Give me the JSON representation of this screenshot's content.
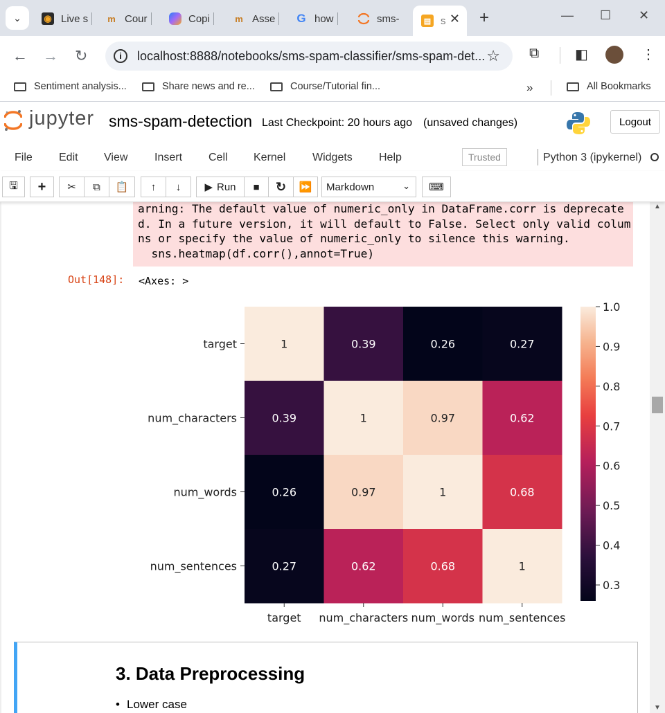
{
  "browser": {
    "tabs": [
      {
        "label": "Live s",
        "icon": "live-icon"
      },
      {
        "label": "Cour",
        "icon": "coursera-icon"
      },
      {
        "label": "Copi",
        "icon": "copilot-icon"
      },
      {
        "label": "Asse",
        "icon": "coursera-icon"
      },
      {
        "label": "how",
        "icon": "google-icon"
      },
      {
        "label": "sms-",
        "icon": "jupyter-icon"
      },
      {
        "label": "s",
        "icon": "notebook-icon",
        "active": true
      }
    ],
    "url": "localhost:8888/notebooks/sms-spam-classifier/sms-spam-det...",
    "bookmarks": [
      "Sentiment analysis...",
      "Share news and re...",
      "Course/Tutorial fin..."
    ],
    "all_bookmarks": "All Bookmarks"
  },
  "jupyter": {
    "logo_text": "jupyter",
    "notebook_name": "sms-spam-detection",
    "checkpoint": "Last Checkpoint: 20 hours ago",
    "unsaved": "(unsaved changes)",
    "logout": "Logout",
    "menus": [
      "File",
      "Edit",
      "View",
      "Insert",
      "Cell",
      "Kernel",
      "Widgets",
      "Help"
    ],
    "trusted": "Trusted",
    "kernel": "Python 3 (ipykernel)",
    "run_label": "Run",
    "cell_type": "Markdown"
  },
  "output": {
    "stderr_lines": [
      "arning: The default value of numeric_only in DataFrame.corr is deprecate",
      "d. In a future version, it will default to False. Select only valid colum",
      "ns or specify the value of numeric_only to silence this warning.",
      "  sns.heatmap(df.corr(),annot=True)"
    ],
    "prompt": "Out[148]:",
    "text": "<Axes: >"
  },
  "chart_data": {
    "type": "heatmap",
    "rows": [
      "target",
      "num_characters",
      "num_words",
      "num_sentences"
    ],
    "columns": [
      "target",
      "num_characters",
      "num_words",
      "num_sentences"
    ],
    "values": [
      [
        1,
        0.39,
        0.26,
        0.27
      ],
      [
        0.39,
        1,
        0.97,
        0.62
      ],
      [
        0.26,
        0.97,
        1,
        0.68
      ],
      [
        0.27,
        0.62,
        0.68,
        1
      ]
    ],
    "annotations": [
      [
        "1",
        "0.39",
        "0.26",
        "0.27"
      ],
      [
        "0.39",
        "1",
        "0.97",
        "0.62"
      ],
      [
        "0.26",
        "0.97",
        "1",
        "0.68"
      ],
      [
        "0.27",
        "0.62",
        "0.68",
        "1"
      ]
    ],
    "colormap": "rocket",
    "colorbar": {
      "min": 0.26,
      "max": 1.0,
      "ticks": [
        1.0,
        0.9,
        0.8,
        0.7,
        0.6,
        0.5,
        0.4,
        0.3
      ]
    }
  },
  "markdown": {
    "heading": "3. Data Preprocessing",
    "items": [
      "Lower case"
    ]
  }
}
